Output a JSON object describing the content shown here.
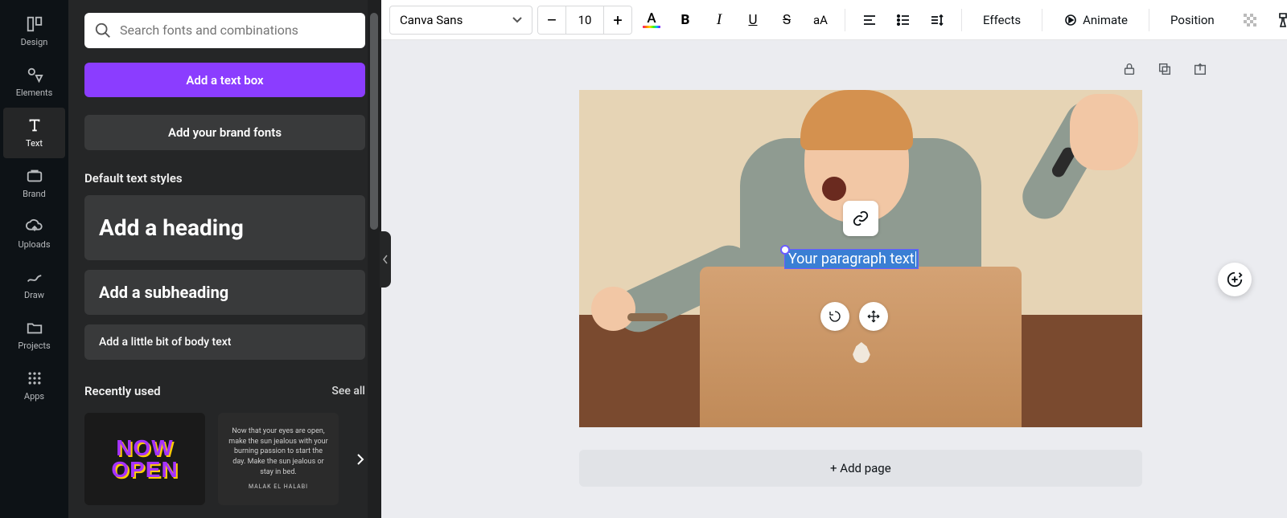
{
  "nav": {
    "items": [
      {
        "label": "Design",
        "icon": "design-icon"
      },
      {
        "label": "Elements",
        "icon": "elements-icon"
      },
      {
        "label": "Text",
        "icon": "text-icon"
      },
      {
        "label": "Brand",
        "icon": "brand-icon"
      },
      {
        "label": "Uploads",
        "icon": "uploads-icon"
      },
      {
        "label": "Draw",
        "icon": "draw-icon"
      },
      {
        "label": "Projects",
        "icon": "projects-icon"
      },
      {
        "label": "Apps",
        "icon": "apps-icon"
      }
    ],
    "active_index": 2
  },
  "panel": {
    "search_placeholder": "Search fonts and combinations",
    "add_text_box": "Add a text box",
    "add_brand_fonts": "Add your brand fonts",
    "default_styles_label": "Default text styles",
    "heading_btn": "Add a heading",
    "subheading_btn": "Add a subheading",
    "body_btn": "Add a little bit of body text",
    "recent_label": "Recently used",
    "see_all": "See all",
    "recent": {
      "card1_line1": "NOW",
      "card1_line2": "OPEN",
      "card2_quote": "Now that your eyes are open, make the sun jealous with your burning passion to start the day. Make the sun jealous or stay in bed.",
      "card2_author": "MALAK EL HALABI"
    }
  },
  "toolbar": {
    "font_name": "Canva Sans",
    "font_size": "10",
    "decrease": "–",
    "increase": "+",
    "text_color_letter": "A",
    "bold": "B",
    "italic": "I",
    "underline": "U",
    "strike": "S",
    "case": "aA",
    "effects": "Effects",
    "animate": "Animate",
    "position": "Position"
  },
  "canvas": {
    "text_content": "Your paragraph text",
    "add_page": "+ Add page"
  },
  "colors": {
    "primary": "#8b3dff",
    "panel_bg": "#252627",
    "nav_bg": "#0d1216"
  }
}
